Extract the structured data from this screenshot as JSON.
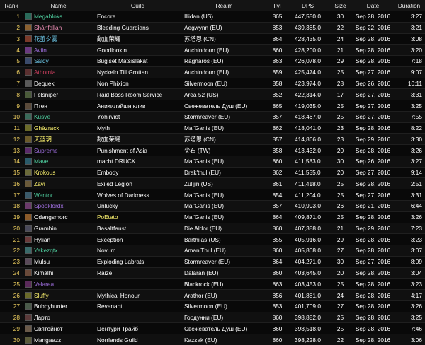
{
  "headers": [
    "Rank",
    "Name",
    "Guild",
    "Realm",
    "Ilvl",
    "DPS",
    "Size",
    "Date",
    "Duration"
  ],
  "rows": [
    {
      "rank": "1",
      "name": "Megabloks",
      "guild": "Encore",
      "realm": "Illidan (US)",
      "ilvl": "865",
      "dps": "447,550.0",
      "size": "30",
      "date": "Sep 28, 2016",
      "duration": "3:27",
      "cls": "monk",
      "icon": "#2a6a5a"
    },
    {
      "rank": "2",
      "name": "Shánfallah",
      "guild": "Bleeding Guardians",
      "realm": "Aegwynn (EU)",
      "ilvl": "853",
      "dps": "439,385.0",
      "size": "22",
      "date": "Sep 22, 2016",
      "duration": "3:21",
      "cls": "paladin",
      "icon": "#8a6030"
    },
    {
      "rank": "3",
      "name": "花茧夕雾",
      "guild": "歃血荣耀",
      "realm": "苏塔恩 (CN)",
      "ilvl": "864",
      "dps": "428,435.0",
      "size": "24",
      "date": "Sep 28, 2016",
      "duration": "3:08",
      "cls": "mage",
      "icon": "#7a3a2a"
    },
    {
      "rank": "4",
      "name": "Aviin",
      "guild": "Goodlookin",
      "realm": "Auchindoun (EU)",
      "ilvl": "860",
      "dps": "428,200.0",
      "size": "21",
      "date": "Sep 28, 2016",
      "duration": "3:20",
      "cls": "warlock",
      "icon": "#6a3a80"
    },
    {
      "rank": "5",
      "name": "Saldy",
      "guild": "Bugiset Matsislakat",
      "realm": "Ragnaros (EU)",
      "ilvl": "863",
      "dps": "426,078.0",
      "size": "29",
      "date": "Sep 28, 2016",
      "duration": "7:18",
      "cls": "mage",
      "icon": "#3a4a6a"
    },
    {
      "rank": "6",
      "name": "Athomia",
      "guild": "Nyckeln Till Grottan",
      "realm": "Auchindoun (EU)",
      "ilvl": "859",
      "dps": "425,474.0",
      "size": "25",
      "date": "Sep 27, 2016",
      "duration": "9:07",
      "cls": "dk",
      "icon": "#5a3030"
    },
    {
      "rank": "7",
      "name": "Dequek",
      "guild": "Non Phixion",
      "realm": "Silvermoon (EU)",
      "ilvl": "858",
      "dps": "423,974.0",
      "size": "28",
      "date": "Sep 26, 2016",
      "duration": "10:11",
      "cls": "white",
      "icon": "#5a5a5a"
    },
    {
      "rank": "8",
      "name": "Felsniper",
      "guild": "Raid Boss Room Service",
      "realm": "Area 52 (US)",
      "ilvl": "852",
      "dps": "422,314.0",
      "size": "17",
      "date": "Sep 27, 2016",
      "duration": "3:31",
      "cls": "white",
      "icon": "#4a5a3a"
    },
    {
      "rank": "9",
      "name": "Птен",
      "guild": "Анихилэйшн клив",
      "realm": "Свежеватель Душ (EU)",
      "ilvl": "865",
      "dps": "419,035.0",
      "size": "25",
      "date": "Sep 27, 2016",
      "duration": "3:25",
      "cls": "white",
      "icon": "#5a4a3a"
    },
    {
      "rank": "10",
      "name": "Kusve",
      "guild": "Yöhirviöt",
      "realm": "Stormreaver (EU)",
      "ilvl": "857",
      "dps": "418,467.0",
      "size": "25",
      "date": "Sep 27, 2016",
      "duration": "7:55",
      "cls": "monk",
      "icon": "#3a6a5a"
    },
    {
      "rank": "11",
      "name": "Ghàzrack",
      "guild": "Myth",
      "realm": "Mal'Ganis (EU)",
      "ilvl": "862",
      "dps": "418,041.0",
      "size": "23",
      "date": "Sep 28, 2016",
      "duration": "8:22",
      "cls": "rogue",
      "icon": "#6a6a2a"
    },
    {
      "rank": "12",
      "name": "天蓝玥",
      "guild": "歃血荣耀",
      "realm": "苏塔恩 (CN)",
      "ilvl": "857",
      "dps": "414,866.0",
      "size": "23",
      "date": "Sep 29, 2016",
      "duration": "3:30",
      "cls": "rogue",
      "icon": "#6a5a2a"
    },
    {
      "rank": "13",
      "name": "Supreme",
      "guild": "Punishment of Asia",
      "realm": "尖石 (TW)",
      "ilvl": "858",
      "dps": "413,432.0",
      "size": "20",
      "date": "Sep 28, 2016",
      "duration": "3:26",
      "cls": "warlock",
      "icon": "#5a2a6a"
    },
    {
      "rank": "14",
      "name": "Mave",
      "guild": "macht DRUCK",
      "realm": "Mal'Ganis (EU)",
      "ilvl": "860",
      "dps": "411,583.0",
      "size": "30",
      "date": "Sep 26, 2016",
      "duration": "3:27",
      "cls": "monk",
      "icon": "#2a5a6a"
    },
    {
      "rank": "15",
      "name": "Krokous",
      "guild": "Embody",
      "realm": "Drak'thul (EU)",
      "ilvl": "862",
      "dps": "411,555.0",
      "size": "20",
      "date": "Sep 27, 2016",
      "duration": "9:14",
      "cls": "rogue",
      "icon": "#6a6a3a"
    },
    {
      "rank": "16",
      "name": "Zavi",
      "guild": "Exiled Legion",
      "realm": "Zul'jin (US)",
      "ilvl": "861",
      "dps": "411,418.0",
      "size": "25",
      "date": "Sep 28, 2016",
      "duration": "2:51",
      "cls": "rogue",
      "icon": "#6a5a3a"
    },
    {
      "rank": "17",
      "name": "Wentor",
      "guild": "Wolves of Darkness",
      "realm": "Mal'Ganis (EU)",
      "ilvl": "854",
      "dps": "411,204.0",
      "size": "25",
      "date": "Sep 27, 2016",
      "duration": "3:31",
      "cls": "monk",
      "icon": "#3a5a6a"
    },
    {
      "rank": "18",
      "name": "Spooklordx",
      "guild": "Unlucky",
      "realm": "Mal'Ganis (EU)",
      "ilvl": "857",
      "dps": "410,993.0",
      "size": "26",
      "date": "Sep 21, 2016",
      "duration": "6:44",
      "cls": "warlock",
      "icon": "#6a3a6a"
    },
    {
      "rank": "19",
      "name": "Odangsmorc",
      "guild": "PoEtato",
      "realm": "Mal'Ganis (EU)",
      "ilvl": "864",
      "dps": "409,871.0",
      "size": "25",
      "date": "Sep 28, 2016",
      "duration": "3:26",
      "cls": "white",
      "icon": "#8a5a2a",
      "guild_cls": "rogue"
    },
    {
      "rank": "20",
      "name": "Grambin",
      "guild": "Basaltfaust",
      "realm": "Die Aldor (EU)",
      "ilvl": "860",
      "dps": "407,388.0",
      "size": "21",
      "date": "Sep 29, 2016",
      "duration": "7:23",
      "cls": "white",
      "icon": "#4a4a5a"
    },
    {
      "rank": "21",
      "name": "Hylian",
      "guild": "Exception",
      "realm": "Barthilas (US)",
      "ilvl": "855",
      "dps": "405,916.0",
      "size": "29",
      "date": "Sep 28, 2016",
      "duration": "3:23",
      "cls": "white",
      "icon": "#6a3a3a"
    },
    {
      "rank": "22",
      "name": "Yekezqtx",
      "guild": "Novum",
      "realm": "Aman'Thul (EU)",
      "ilvl": "860",
      "dps": "405,808.0",
      "size": "27",
      "date": "Sep 28, 2016",
      "duration": "3:07",
      "cls": "monk",
      "icon": "#3a6a6a"
    },
    {
      "rank": "23",
      "name": "Mulsu",
      "guild": "Exploding Labrats",
      "realm": "Stormreaver (EU)",
      "ilvl": "864",
      "dps": "404,271.0",
      "size": "30",
      "date": "Sep 27, 2016",
      "duration": "8:09",
      "cls": "white",
      "icon": "#5a4a5a"
    },
    {
      "rank": "24",
      "name": "Kimalhi",
      "guild": "Raize",
      "realm": "Dalaran (EU)",
      "ilvl": "860",
      "dps": "403,645.0",
      "size": "20",
      "date": "Sep 28, 2016",
      "duration": "3:04",
      "cls": "white",
      "icon": "#6a4a3a"
    },
    {
      "rank": "25",
      "name": "Velarea",
      "guild": "",
      "realm": "Blackrock (EU)",
      "ilvl": "863",
      "dps": "403,453.0",
      "size": "25",
      "date": "Sep 28, 2016",
      "duration": "3:23",
      "cls": "warlock",
      "icon": "#5a2a5a"
    },
    {
      "rank": "26",
      "name": "Sluffy",
      "guild": "Mythical Honour",
      "realm": "Arathor (EU)",
      "ilvl": "856",
      "dps": "401,881.0",
      "size": "24",
      "date": "Sep 28, 2016",
      "duration": "4:17",
      "cls": "rogue",
      "icon": "#6a6a2a"
    },
    {
      "rank": "27",
      "name": "Bubbyhunter",
      "guild": "Revenant",
      "realm": "Silvermoon (EU)",
      "ilvl": "853",
      "dps": "401,709.0",
      "size": "27",
      "date": "Sep 28, 2016",
      "duration": "3:26",
      "cls": "white",
      "icon": "#4a5a4a"
    },
    {
      "rank": "28",
      "name": "Ларто",
      "guild": "",
      "realm": "Гордунни (EU)",
      "ilvl": "860",
      "dps": "398,882.0",
      "size": "25",
      "date": "Sep 28, 2016",
      "duration": "3:25",
      "cls": "white",
      "icon": "#5a3a3a"
    },
    {
      "rank": "29",
      "name": "Святойнот",
      "guild": "Центури Трайб",
      "realm": "Свежеватель Душ (EU)",
      "ilvl": "860",
      "dps": "398,518.0",
      "size": "25",
      "date": "Sep 28, 2016",
      "duration": "7:46",
      "cls": "white",
      "icon": "#6a5a4a"
    },
    {
      "rank": "30",
      "name": "Mangaazz",
      "guild": "Norrlands Guild",
      "realm": "Kazzak (EU)",
      "ilvl": "860",
      "dps": "398,228.0",
      "size": "22",
      "date": "Sep 28, 2016",
      "duration": "3:06",
      "cls": "white",
      "icon": "#5a5a3a"
    }
  ],
  "colors": {
    "rank_text": "#f0d060",
    "white": "#ffffff",
    "monk": "#4fd0a0",
    "paladin": "#f090b8",
    "mage": "#6ec8e8",
    "warlock": "#a070e0",
    "rogue": "#fff570",
    "dk": "#d04060",
    "header_bg": "#141414",
    "page_bg": "#000000"
  }
}
